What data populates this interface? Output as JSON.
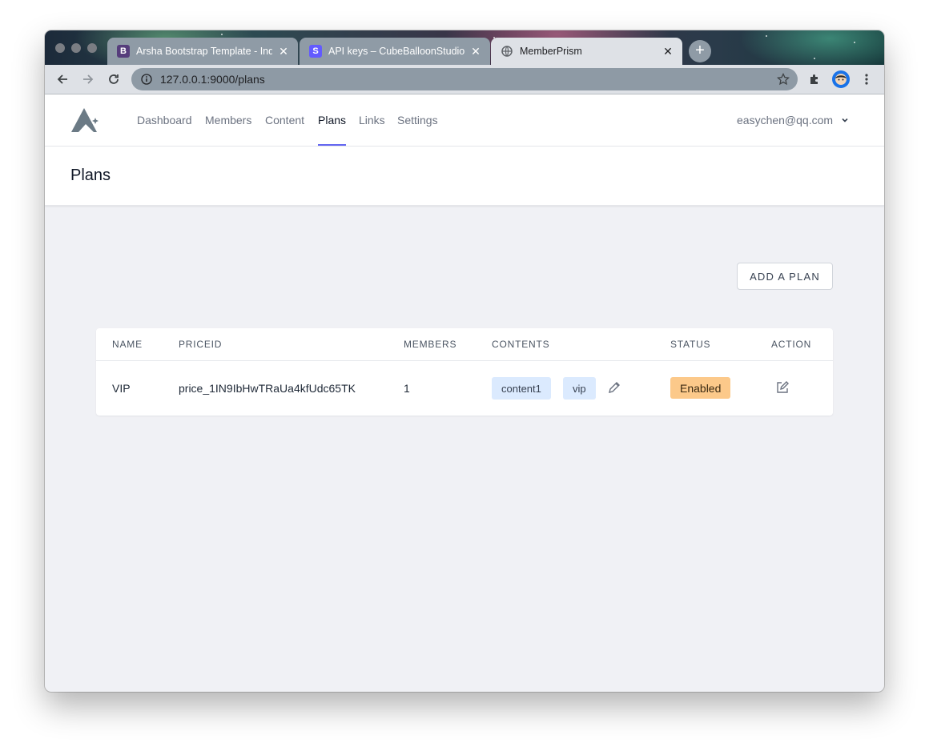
{
  "browser": {
    "tabs": [
      {
        "title": "Arsha Bootstrap Template - Index",
        "favicon": "B",
        "favicon_color": "#563d7c",
        "active": false
      },
      {
        "title": "API keys – CubeBalloonStudio",
        "favicon": "S",
        "favicon_color": "#635bff",
        "active": false
      },
      {
        "title": "MemberPrism",
        "favicon": "globe-icon",
        "active": true
      }
    ],
    "url": "127.0.0.1:9000/plans"
  },
  "nav": {
    "links": [
      "Dashboard",
      "Members",
      "Content",
      "Plans",
      "Links",
      "Settings"
    ],
    "active": "Plans",
    "user_email": "easychen@qq.com",
    "accent_color": "#6366f1"
  },
  "page": {
    "title": "Plans",
    "add_button": "ADD A PLAN"
  },
  "table": {
    "headers": [
      "NAME",
      "PRICEID",
      "MEMBERS",
      "CONTENTS",
      "STATUS",
      "ACTION"
    ],
    "rows": [
      {
        "name": "VIP",
        "price_id": "price_1IN9IbHwTRaUa4kfUdc65TK",
        "members": "1",
        "contents": [
          "content1",
          "vip"
        ],
        "status": "Enabled",
        "status_color": "#fcc98a"
      }
    ]
  }
}
